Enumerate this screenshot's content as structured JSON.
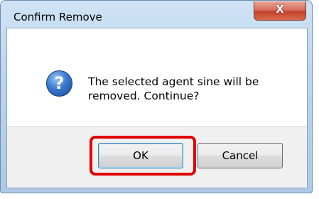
{
  "window": {
    "title": "Confirm Remove",
    "close_glyph": "X"
  },
  "dialog": {
    "icon": "question-icon",
    "icon_glyph": "?",
    "message_line1": "The selected agent sine will be",
    "message_line2": "removed. Continue?"
  },
  "buttons": {
    "ok_label": "OK",
    "cancel_label": "Cancel"
  },
  "annotation": {
    "highlight_color": "#e00000",
    "highlighted": "ok-button"
  },
  "colors": {
    "titlebar": "#bcd5ee",
    "close_button": "#c5412c",
    "footer": "#f0f0f0",
    "icon_blue": "#3a78cf"
  }
}
